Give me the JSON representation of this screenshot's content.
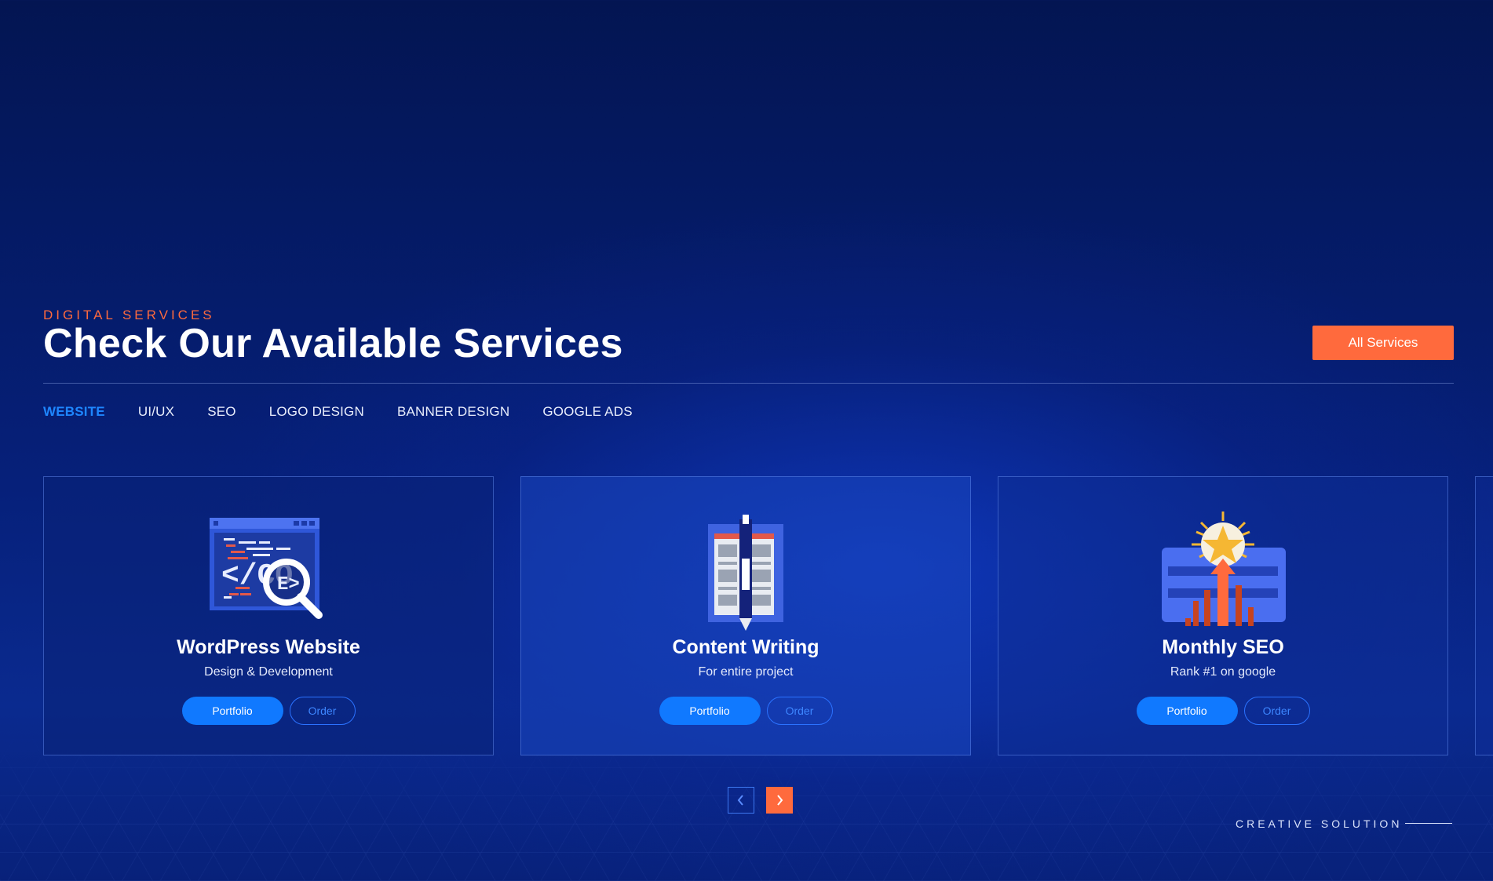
{
  "hero": {
    "eyebrow": "DIGITAL SERVICES",
    "title": "Check Our Available Services",
    "all_services_label": "All Services"
  },
  "tabs": [
    {
      "label": "WEBSITE",
      "active": true
    },
    {
      "label": "UI/UX",
      "active": false
    },
    {
      "label": "SEO",
      "active": false
    },
    {
      "label": "LOGO DESIGN",
      "active": false
    },
    {
      "label": "BANNER DESIGN",
      "active": false
    },
    {
      "label": "GOOGLE ADS",
      "active": false
    }
  ],
  "cards": [
    {
      "icon": "code-search-icon",
      "name": "WordPress Website",
      "subtitle": "Design & Development",
      "portfolio_label": "Portfolio",
      "order_label": "Order"
    },
    {
      "icon": "document-pen-icon",
      "name": "Content Writing",
      "subtitle": "For entire project",
      "portfolio_label": "Portfolio",
      "order_label": "Order"
    },
    {
      "icon": "star-rank-icon",
      "name": "Monthly SEO",
      "subtitle": "Rank #1 on google",
      "portfolio_label": "Portfolio",
      "order_label": "Order"
    }
  ],
  "footer": {
    "tagline": "CREATIVE SOLUTION"
  },
  "colors": {
    "accent_orange": "#ff6a3d",
    "accent_blue": "#1079ff",
    "background": "#06207a"
  }
}
